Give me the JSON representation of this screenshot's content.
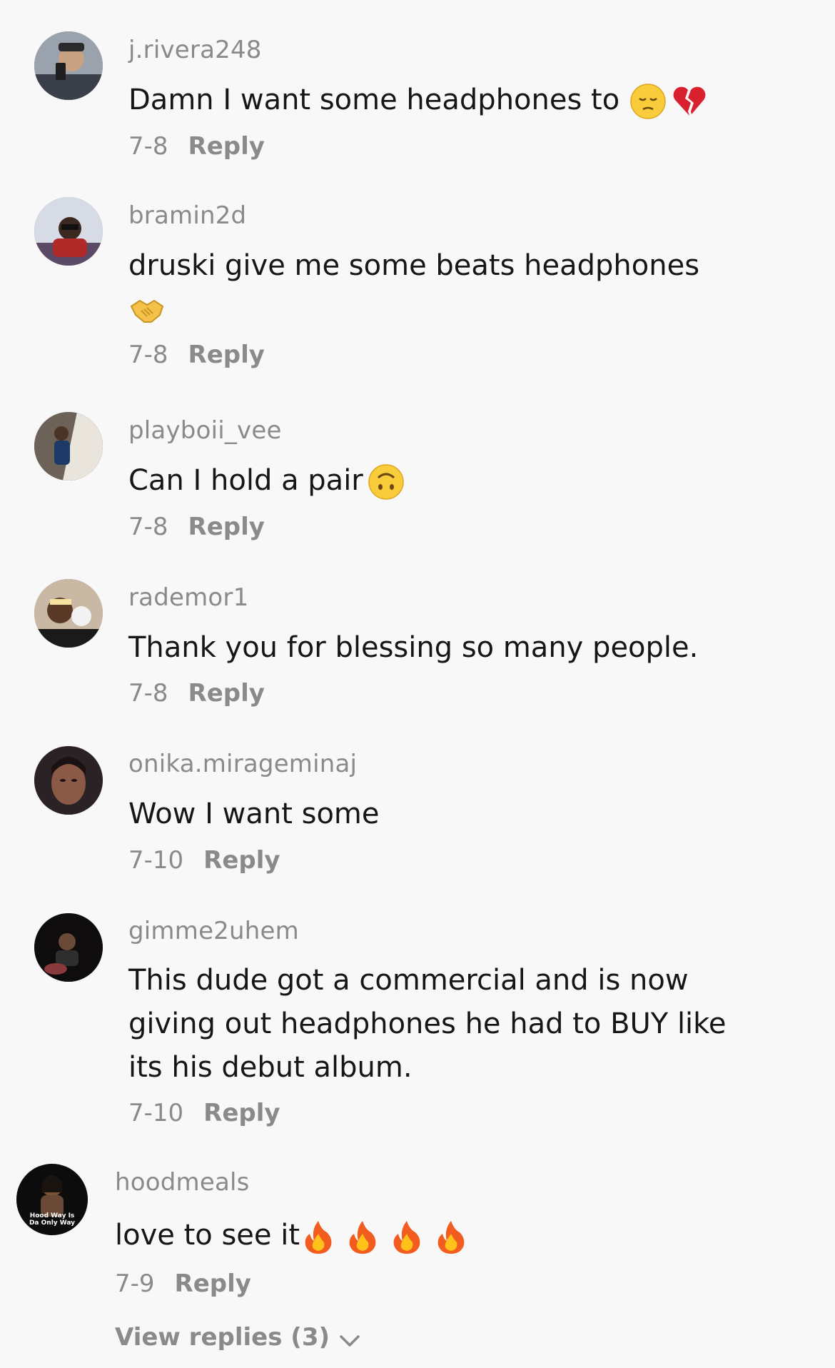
{
  "reply_label": "Reply",
  "comments": [
    {
      "username": "j.rivera248",
      "text": "Damn I want some headphones to",
      "emojis": [
        "pensive-face-emoji",
        "broken-heart-emoji"
      ],
      "date": "7-8"
    },
    {
      "username": "bramin2d",
      "text": "druski give me some beats headphones",
      "emojis": [
        "handshake-emoji"
      ],
      "date": "7-8"
    },
    {
      "username": "playboii_vee",
      "text": "Can I hold a pair",
      "emojis": [
        "upside-down-face-emoji"
      ],
      "date": "7-8"
    },
    {
      "username": "rademor1",
      "text": "Thank you for blessing so many people.",
      "emojis": [],
      "date": "7-8"
    },
    {
      "username": "onika.mirageminaj",
      "text": "Wow I want some",
      "emojis": [],
      "date": "7-10"
    },
    {
      "username": "gimme2uhem",
      "text": "This dude got a commercial and is now giving out headphones he had to BUY like its his debut album.",
      "emojis": [],
      "date": "7-10"
    },
    {
      "username": "hoodmeals",
      "text": "love to see it",
      "emojis": [
        "fire-emoji",
        "fire-emoji",
        "fire-emoji",
        "fire-emoji"
      ],
      "date": "7-9",
      "avatar_text": "Hood Way Is Da Only Way"
    }
  ],
  "view_replies": "View replies (3)",
  "colors": {
    "background": "#f8f8f8",
    "username": "#8a8a8a",
    "text": "#161616",
    "meta": "#8a8a8a"
  }
}
